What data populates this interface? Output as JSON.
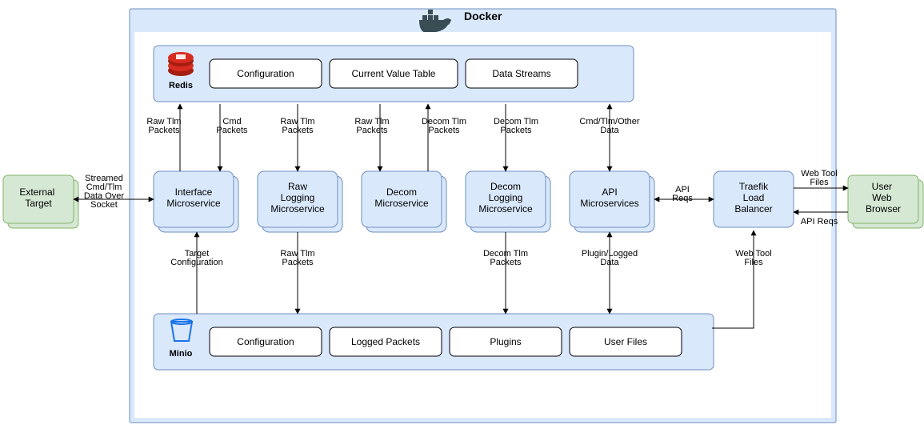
{
  "docker": {
    "title": "Docker"
  },
  "redis": {
    "label": "Redis",
    "items": [
      "Configuration",
      "Current Value Table",
      "Data Streams"
    ]
  },
  "minio": {
    "label": "Minio",
    "items": [
      "Configuration",
      "Logged Packets",
      "Plugins",
      "User Files"
    ]
  },
  "microservices": {
    "interface": "Interface Microservice",
    "raw_log": "Raw Logging Microservice",
    "decom": "Decom Microservice",
    "decom_log": "Decom Logging Microservice",
    "api": "API Microservices",
    "traefik": "Traefik Load Balancer"
  },
  "external": {
    "target": "External Target",
    "browser": "User Web Browser"
  },
  "edges": {
    "e1": "Streamed Cmd/Tlm Data Over Socket",
    "e2": "Raw Tlm Packets",
    "e3": "Cmd Packets",
    "e4": "Raw Tlm Packets",
    "e5": "Raw Tlm Packets",
    "e6": "Decom Tlm Packets",
    "e7": "Decom Tlm Packets",
    "e8": "Cmd/Tlm/Other Data",
    "e9": "API Reqs",
    "e10": "Web Tool Files",
    "e11": "API Reqs",
    "e12": "Target Configuration",
    "e13": "Raw Tlm Packets",
    "e14": "Decom Tlm Packets",
    "e15": "Plugin/Logged Data",
    "e16": "Web Tool Files"
  }
}
